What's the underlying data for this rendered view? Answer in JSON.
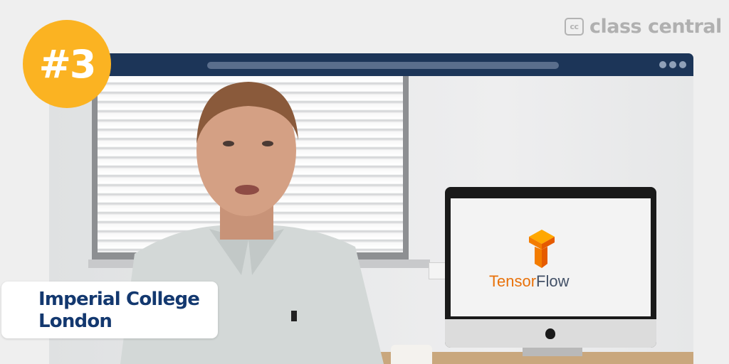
{
  "brand": {
    "icon": "class-central-logo-icon",
    "icon_text": "cc",
    "name": "class central"
  },
  "badge": {
    "rank": "#3",
    "color": "#fbb322"
  },
  "provider": {
    "line1": "Imperial College",
    "line2": "London",
    "color": "#13386f"
  },
  "browser": {
    "titlebar_color": "#1c3558"
  },
  "monitor_screen": {
    "logo_icon": "tensorflow-logo-icon",
    "brand_part1": "Tensor",
    "brand_part2": "Flow"
  }
}
